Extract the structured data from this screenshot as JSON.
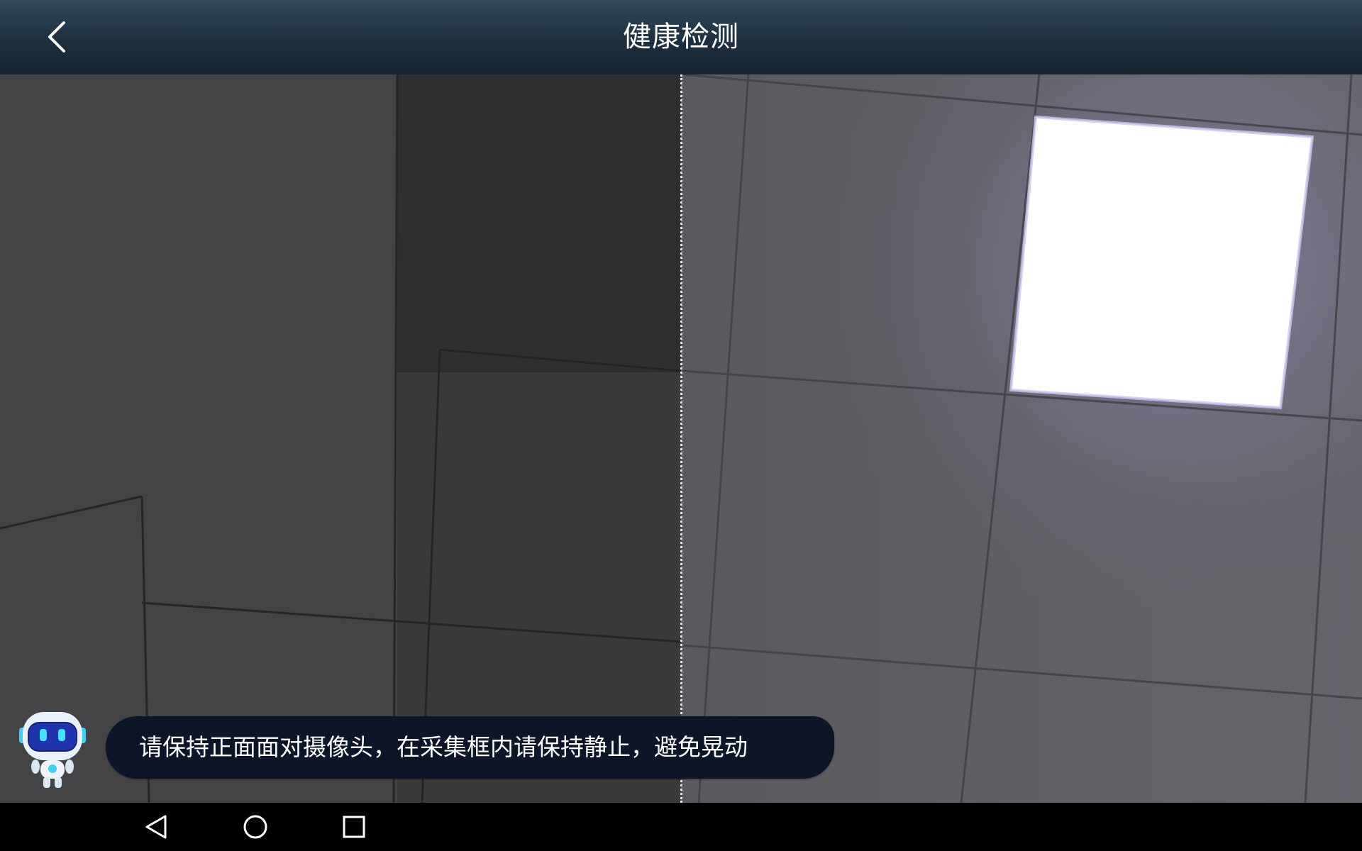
{
  "header": {
    "title": "健康检测",
    "back_icon": "back-arrow-icon"
  },
  "camera": {
    "icon": "camera-preview"
  },
  "message": {
    "text": "请保持正面面对摄像头，在采集框内请保持静止，避免晃动",
    "avatar_icon": "robot-mascot-icon"
  },
  "nav_bar": {
    "back_icon": "triangle-back-icon",
    "home_icon": "circle-home-icon",
    "recents_icon": "square-recents-icon"
  },
  "colors": {
    "header_top": "#304a5c",
    "header_bottom": "#142330",
    "bubble_bg": "#0c1628",
    "nav_bar_bg": "#000000"
  }
}
